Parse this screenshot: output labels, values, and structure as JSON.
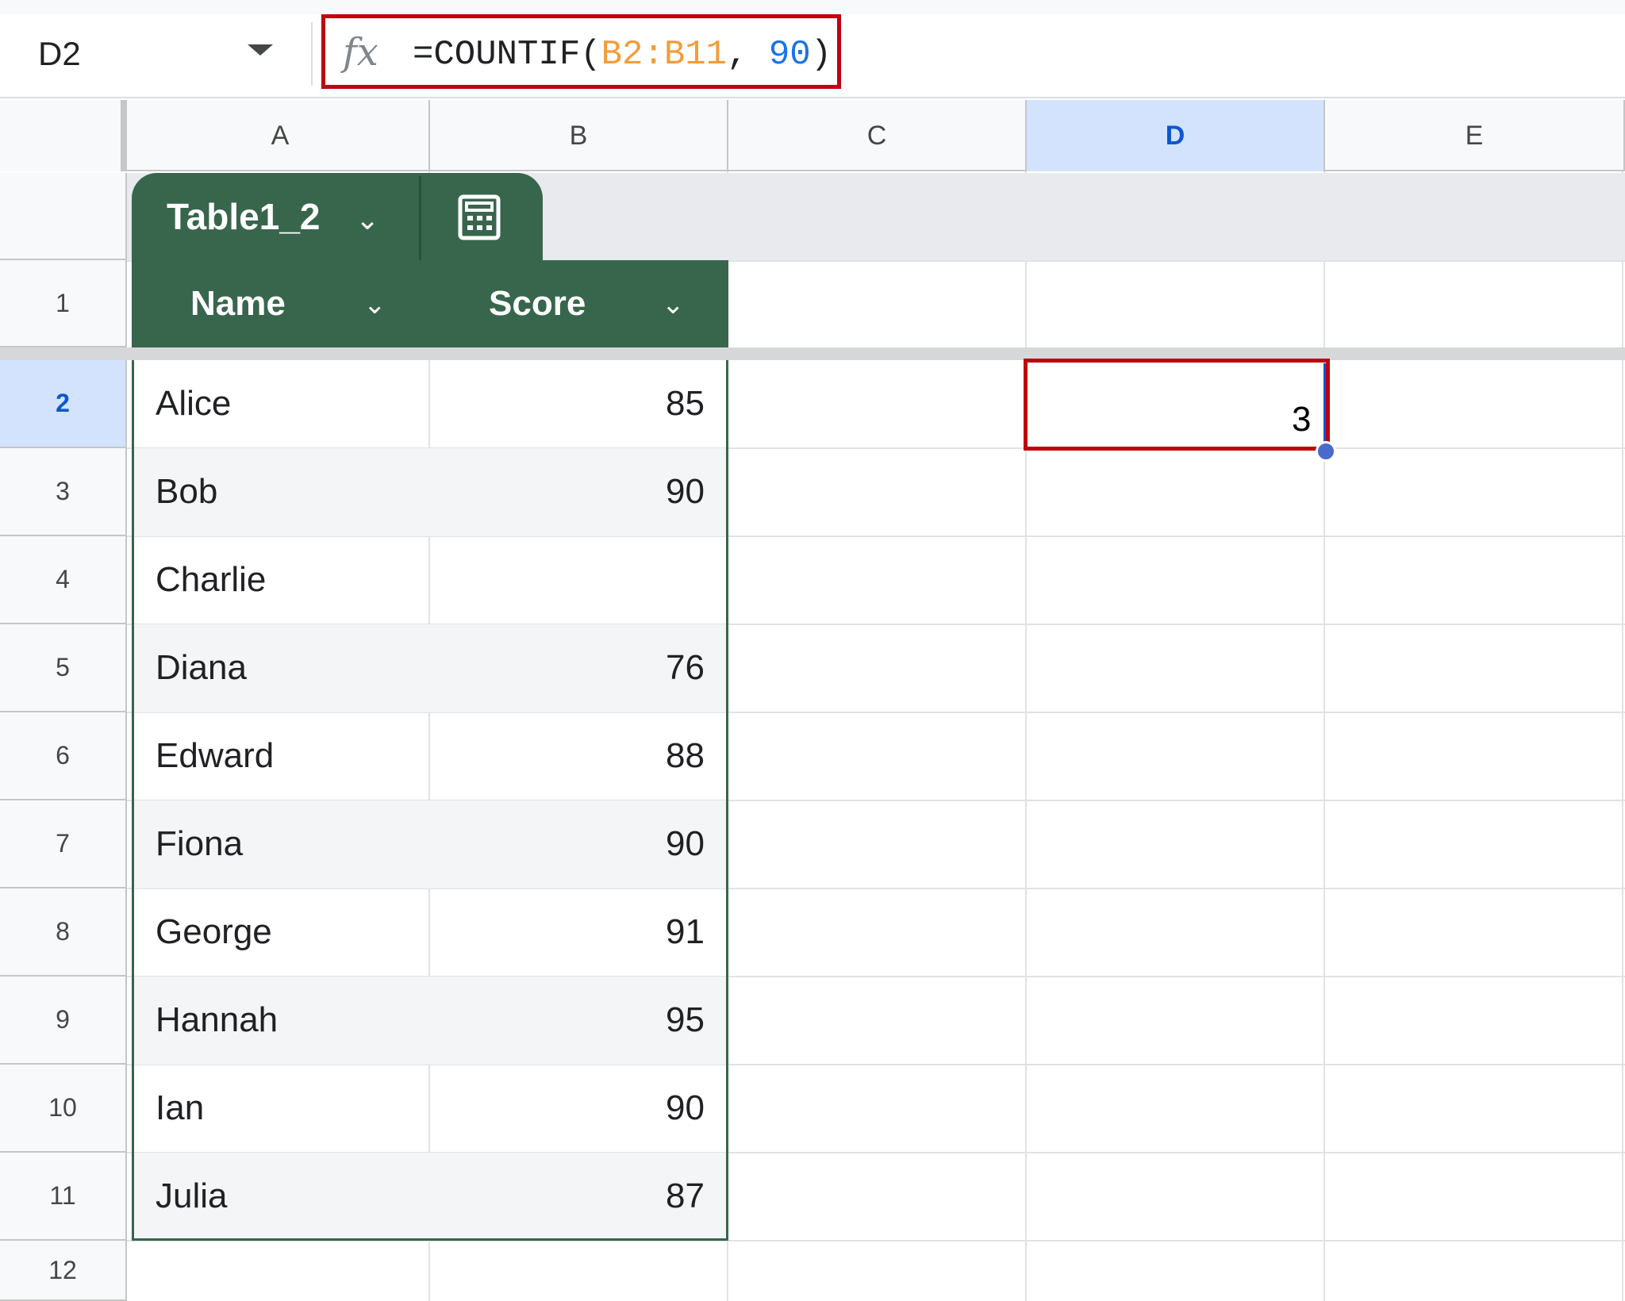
{
  "name_box": {
    "value": "D2"
  },
  "formula": {
    "prefix": "=COUNTIF(",
    "range": "B2:B11",
    "separator": ", ",
    "criterion": "90",
    "suffix": ")"
  },
  "columns": [
    "A",
    "B",
    "C",
    "D",
    "E"
  ],
  "selected_column": "D",
  "table": {
    "name": "Table1_2",
    "headers": [
      "Name",
      "Score"
    ],
    "rows": [
      {
        "name": "Alice",
        "score": "85"
      },
      {
        "name": "Bob",
        "score": "90"
      },
      {
        "name": "Charlie",
        "score": ""
      },
      {
        "name": "Diana",
        "score": "76"
      },
      {
        "name": "Edward",
        "score": "88"
      },
      {
        "name": "Fiona",
        "score": "90"
      },
      {
        "name": "George",
        "score": "91"
      },
      {
        "name": "Hannah",
        "score": "95"
      },
      {
        "name": "Ian",
        "score": "90"
      },
      {
        "name": "Julia",
        "score": "87"
      }
    ]
  },
  "row_numbers": [
    "1",
    "2",
    "3",
    "4",
    "5",
    "6",
    "7",
    "8",
    "9",
    "10",
    "11",
    "12"
  ],
  "selected_row": "2",
  "active_cell": {
    "ref": "D2",
    "value": "3"
  },
  "colors": {
    "table_green": "#38664d",
    "highlight_red": "#c0000f",
    "selection_blue": "#d3e3fd"
  },
  "icons": {
    "formula": "fx-icon",
    "dropdown": "chevron-down-icon",
    "table_calc": "calculator-icon"
  }
}
